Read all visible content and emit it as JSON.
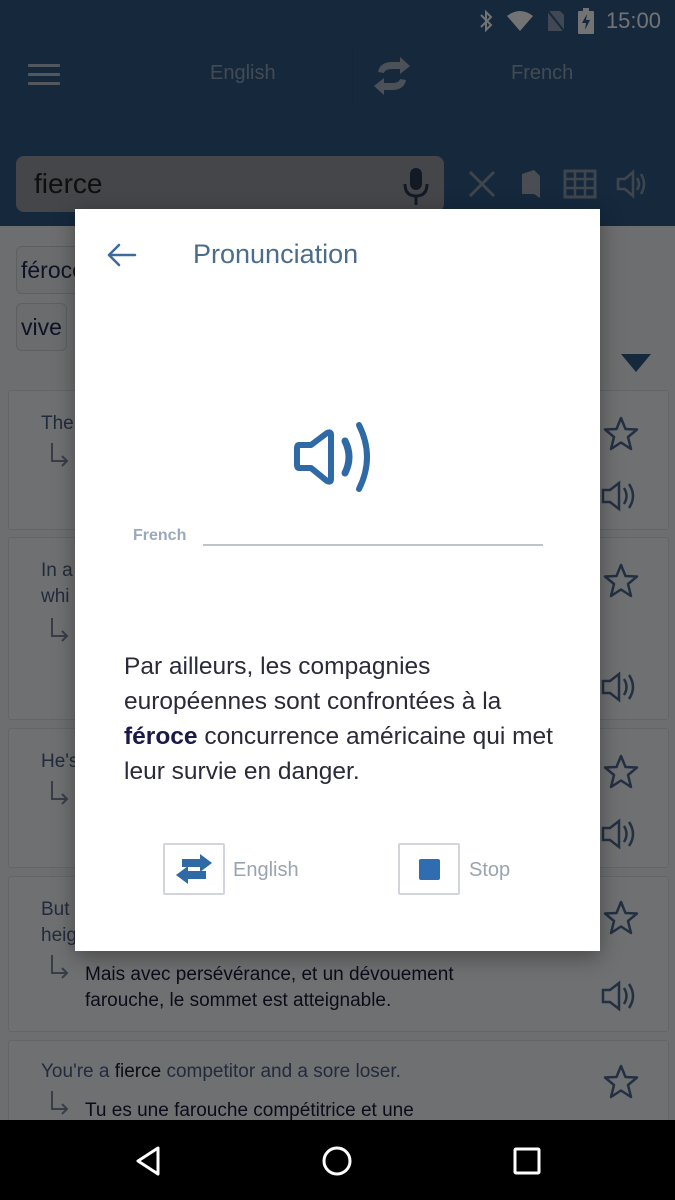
{
  "status_bar": {
    "time": "15:00",
    "icons": [
      "bluetooth-icon",
      "wifi-icon",
      "no-sim-icon",
      "battery-charging-icon"
    ]
  },
  "toolbar": {
    "menu_icon": "hamburger-menu-icon",
    "source_language": "English",
    "target_language": "French",
    "swap_icon": "swap-languages-icon"
  },
  "search": {
    "value": "fierce",
    "mic_icon": "microphone-icon",
    "actions": [
      "clear-icon",
      "bookmark-icon",
      "table-icon",
      "speaker-icon"
    ]
  },
  "translations": {
    "chips": [
      "féroce",
      "vive"
    ]
  },
  "examples": [
    {
      "en": "The",
      "fr": ""
    },
    {
      "en": "In a",
      "en2": "whi",
      "fr": ""
    },
    {
      "en": "He's",
      "fr": ""
    },
    {
      "en": "But",
      "en2": "heig",
      "fr_line1": "Mais avec persévérance, et un dévouement",
      "fr_line2": "farouche, le sommet est atteignable."
    },
    {
      "en_pre": "You're a ",
      "en_bold": "fierce",
      "en_post": " competitor and a sore loser.",
      "fr_line1": "Tu es une farouche compétitrice et une"
    }
  ],
  "dialog": {
    "title": "Pronunciation",
    "back_icon": "back-arrow-icon",
    "speaker_icon": "speaker-icon",
    "field_label": "French",
    "sentence_pre": "Par ailleurs, les compagnies européennes sont confrontées à la ",
    "sentence_bold": "féroce",
    "sentence_post": " concurrence américaine qui met leur survie en danger.",
    "swap_button_label": "English",
    "stop_button_label": "Stop"
  },
  "colors": {
    "appbar": "#2f5a86",
    "accent": "#2f6db0",
    "dialog_title": "#4c6c8c"
  },
  "nav_bar": {
    "buttons": [
      "back-icon",
      "home-icon",
      "recents-icon"
    ]
  }
}
